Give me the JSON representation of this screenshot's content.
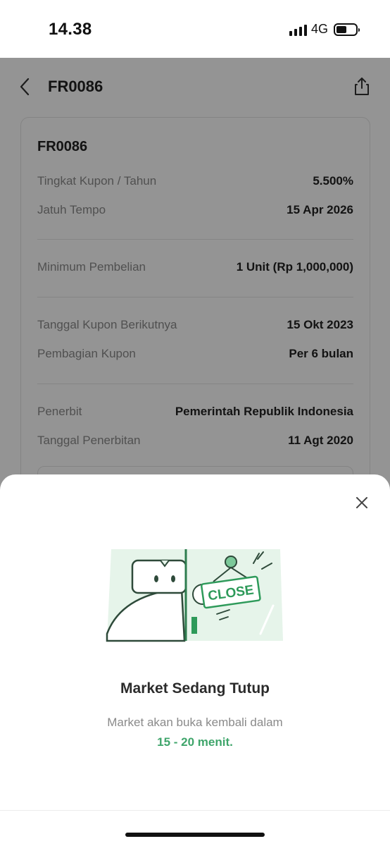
{
  "status_bar": {
    "time": "14.38",
    "network": "4G",
    "battery_level": 0.55,
    "signal_bars": 4
  },
  "header": {
    "title": "FR0086",
    "back_icon": "chevron-left-icon",
    "share_icon": "share-icon"
  },
  "card": {
    "title": "FR0086",
    "sections": [
      [
        {
          "label": "Tingkat Kupon / Tahun",
          "value": "5.500%"
        },
        {
          "label": "Jatuh Tempo",
          "value": "15 Apr 2026"
        }
      ],
      [
        {
          "label": "Minimum Pembelian",
          "value": "1 Unit (Rp 1,000,000)"
        }
      ],
      [
        {
          "label": "Tanggal Kupon Berikutnya",
          "value": "15 Okt 2023"
        },
        {
          "label": "Pembagian Kupon",
          "value": "Per 6 bulan"
        }
      ],
      [
        {
          "label": "Penerbit",
          "value": "Pemerintah Republik Indonesia"
        },
        {
          "label": "Tanggal Penerbitan",
          "value": "11 Agt 2020"
        }
      ]
    ]
  },
  "sheet": {
    "close_icon": "close-icon",
    "illustration_sign": "CLOSE",
    "title": "Market Sedang Tutup",
    "description": "Market akan buka kembali dalam",
    "highlight": "15 - 20 menit."
  },
  "colors": {
    "accent_green": "#3fa56b",
    "light_green": "#e6f4ea",
    "overlay": "rgba(0,0,0,0.42)"
  }
}
